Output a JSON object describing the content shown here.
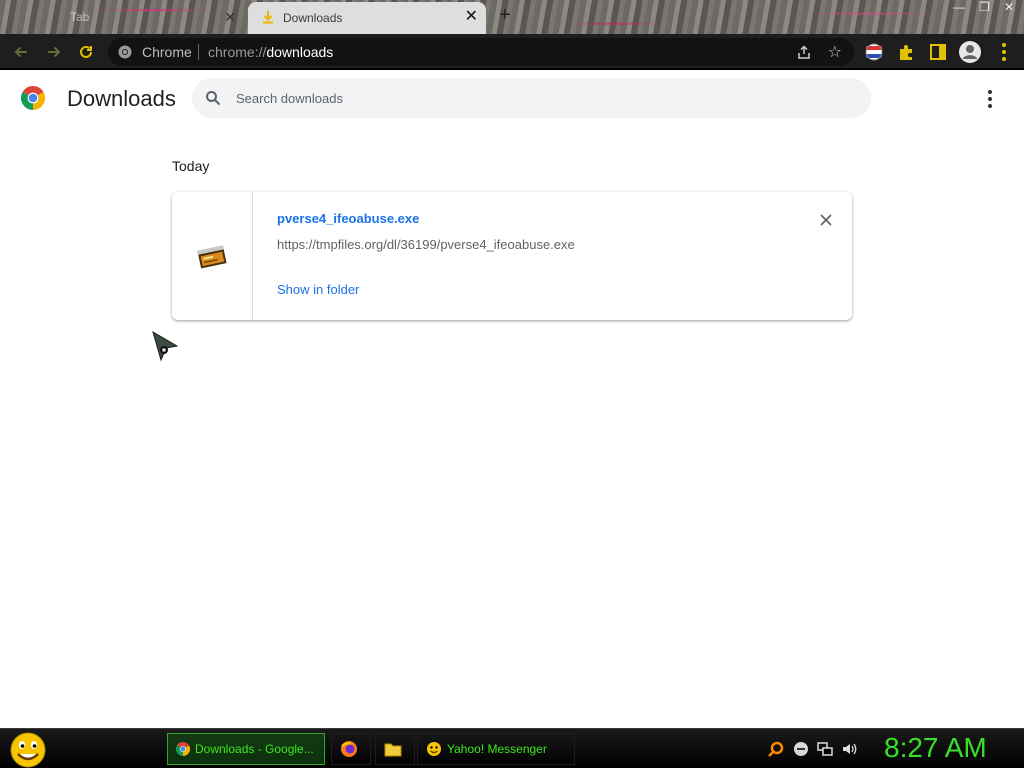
{
  "browser": {
    "tabs": [
      {
        "label": "Tab",
        "active": false
      },
      {
        "label": "Downloads",
        "active": true
      }
    ],
    "omnibox": {
      "chip": "Chrome",
      "url_prefix": "chrome://",
      "url_page": "downloads"
    }
  },
  "page": {
    "title": "Downloads",
    "search": {
      "placeholder": "Search downloads",
      "value": ""
    },
    "sections": [
      {
        "label": "Today",
        "items": [
          {
            "file_name": "pverse4_ifeoabuse.exe",
            "url": "https://tmpfiles.org/dl/36199/pverse4_ifeoabuse.exe",
            "action": "Show in folder"
          }
        ]
      }
    ]
  },
  "taskbar": {
    "tasks": [
      {
        "label": "Downloads - Google...",
        "icon": "chrome-icon",
        "active": true
      },
      {
        "label": "",
        "icon": "firefox-icon",
        "active": false
      },
      {
        "label": "",
        "icon": "folder-icon",
        "active": false
      },
      {
        "label": "Yahoo! Messenger",
        "icon": "yahoo-messenger-icon",
        "active": false
      }
    ],
    "clock": "8:27 AM"
  },
  "colors": {
    "accent_blue": "#1a73e8",
    "taskbar_green": "#3ee81c",
    "toolbar_dark": "#1e1e1e"
  }
}
